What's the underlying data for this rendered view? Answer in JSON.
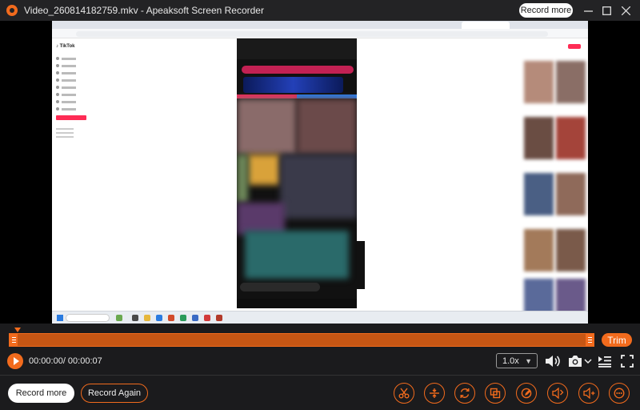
{
  "window": {
    "title": "Video_260814182759.mkv  -  Apeaksoft Screen Recorder",
    "record_more_label": "Record more",
    "controls": [
      "minimize-icon",
      "maximize-icon",
      "close-icon"
    ]
  },
  "player": {
    "trim_label": "Trim",
    "current_time": "00:00:00",
    "total_time": "00:00:07",
    "time_display": "00:00:00/ 00:00:07",
    "speed": "1.0x",
    "progress": 0.0
  },
  "actions": {
    "record_more_label": "Record more",
    "record_again_label": "Record Again",
    "tools": [
      "scissors-icon",
      "split-icon",
      "rotate-icon",
      "crop-icon",
      "edit-icon",
      "volume-adjust-icon",
      "volume-boost-icon",
      "more-icon"
    ]
  },
  "colors": {
    "accent": "#f26b1d",
    "background": "#1b1b1d",
    "titlebar": "#232325"
  }
}
